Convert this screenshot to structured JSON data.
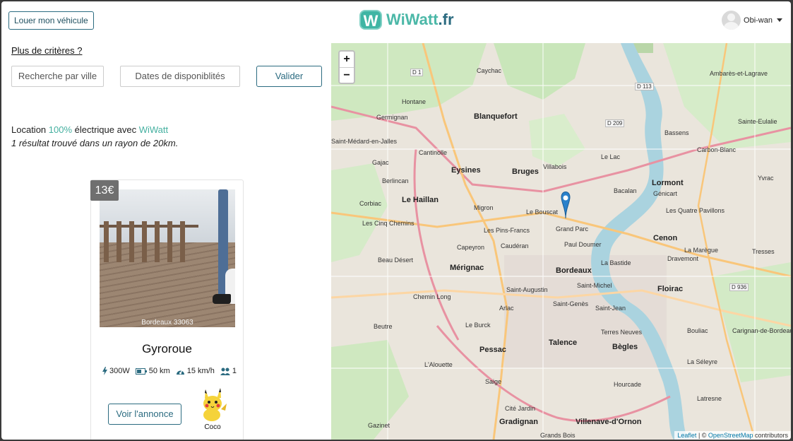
{
  "header": {
    "rent_button": "Louer mon véhicule",
    "logo_mark": "W",
    "logo_wiwatt": "WiWatt",
    "logo_tld": ".fr",
    "username": "Obi-wan"
  },
  "filters": {
    "more_criteria": "Plus de critères ?",
    "city_placeholder": "Recherche par ville",
    "dates_placeholder": "Dates de disponiblités",
    "submit": "Valider"
  },
  "intro": {
    "prefix": "Location ",
    "percent": "100%",
    "middle": " électrique avec ",
    "brand": "WiWatt",
    "results": "1 résultat trouvé dans un rayon de 20km."
  },
  "listing": {
    "price": "13€",
    "location": "Bordeaux 33063",
    "title": "Gyroroue",
    "power": "300W",
    "range": "50 km",
    "speed": "15 km/h",
    "seats": "1",
    "cta": "Voir l'annonce",
    "owner": "Coco"
  },
  "map": {
    "zoom_in": "+",
    "zoom_out": "−",
    "attribution_leaflet": "Leaflet",
    "attribution_sep": " | © ",
    "attribution_osm": "OpenStreetMap",
    "attribution_tail": " contributors",
    "labels": [
      "Caychac",
      "Ambarès-et-Lagrave",
      "Hontane",
      "Germignan",
      "Blanquefort",
      "Saint-Médard-en-Jalles",
      "Cantinolle",
      "Le Lac",
      "Eysines",
      "Bruges",
      "Villabois",
      "Bacalan",
      "Lormont",
      "Le Haillan",
      "Migron",
      "Le Bouscat",
      "Grand Parc",
      "Cenon",
      "Les Cinq Chemins",
      "Les Pins-Francs",
      "Caudéran",
      "Capeyron",
      "Paul Doumer",
      "Beau Désert",
      "Mérignac",
      "Bordeaux",
      "La Bastide",
      "Floirac",
      "Saint-Augustin",
      "Saint-Michel",
      "Chemin Long",
      "Arlac",
      "Saint-Genès",
      "Saint-Jean",
      "Beutre",
      "Le Burck",
      "Terres Neuves",
      "Talence",
      "Bègles",
      "Pessac",
      "L'Alouette",
      "Saige",
      "Hourcade",
      "Cité Jardin",
      "Gradignan",
      "Villenave-d'Ornon",
      "Gazinet",
      "Grands Bois",
      "Sainte-Eulalie",
      "Bassens",
      "Carbon-Blanc",
      "Génicart",
      "Yvrac",
      "Les Quatre Pavillons",
      "La Marègue",
      "Dravemont",
      "Tresses",
      "Bouliac",
      "Carignan-de-Bordeaux",
      "La Séleyre",
      "Latresne",
      "Corbiac",
      "Berlincan",
      "Gajac"
    ],
    "road_tags": [
      "D 1",
      "D 113",
      "D 209",
      "D 936"
    ]
  }
}
